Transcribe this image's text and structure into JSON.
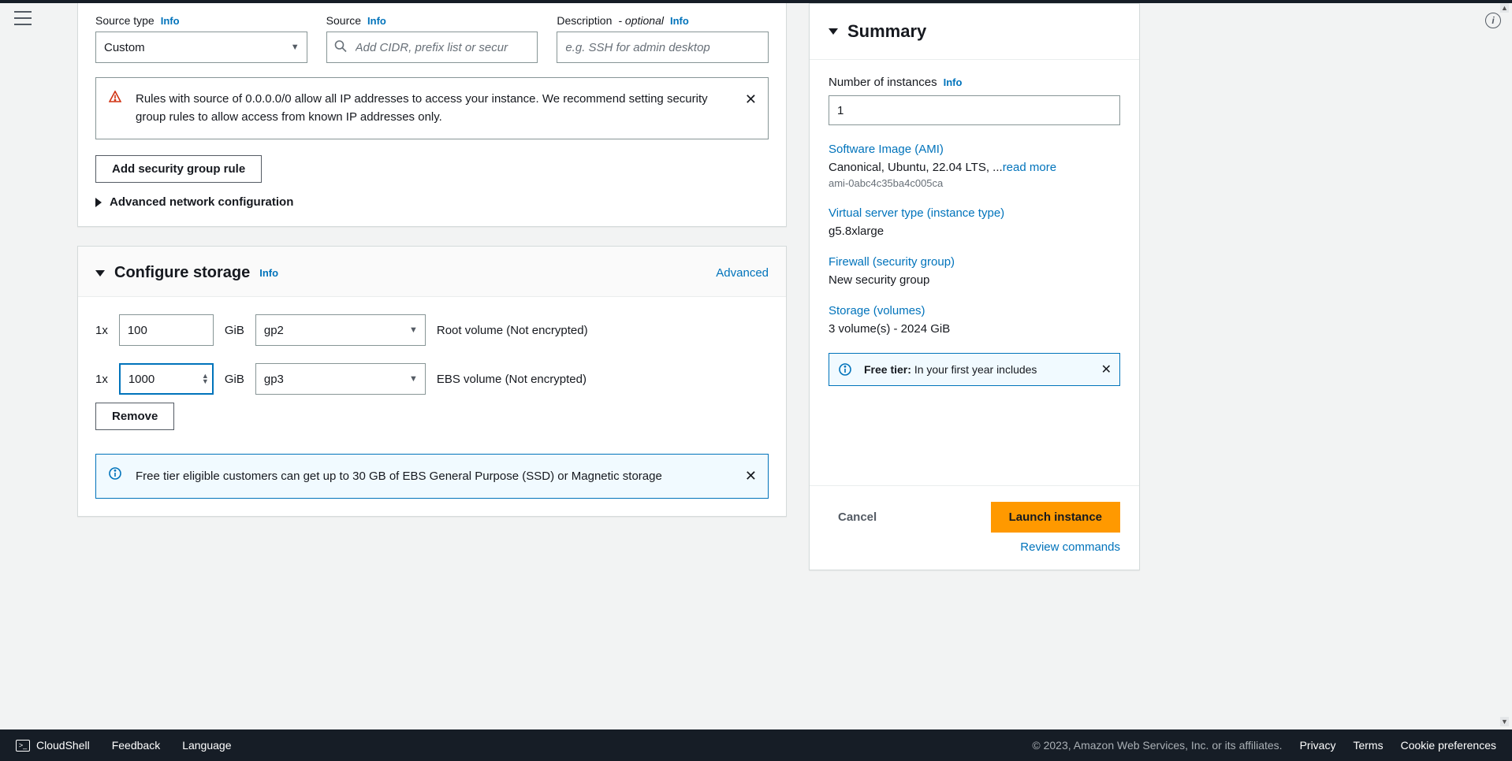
{
  "security": {
    "source_type_label": "Source type",
    "source_type_value": "Custom",
    "source_label": "Source",
    "source_placeholder": "Add CIDR, prefix list or secur",
    "description_label": "Description",
    "description_optional": "- optional",
    "description_placeholder": "e.g. SSH for admin desktop",
    "info": "Info",
    "warning": "Rules with source of 0.0.0.0/0 allow all IP addresses to access your instance. We recommend setting security group rules to allow access from known IP addresses only.",
    "add_rule_btn": "Add security group rule",
    "advanced_network": "Advanced network configuration"
  },
  "storage": {
    "title": "Configure storage",
    "info": "Info",
    "advanced": "Advanced",
    "rows": [
      {
        "mult": "1x",
        "size": "100",
        "unit": "GiB",
        "type": "gp2",
        "desc": "Root volume  (Not encrypted)"
      },
      {
        "mult": "1x",
        "size": "1000",
        "unit": "GiB",
        "type": "gp3",
        "desc": "EBS volume  (Not encrypted)"
      }
    ],
    "remove_btn": "Remove",
    "free_tier": "Free tier eligible customers can get up to 30 GB of EBS General Purpose (SSD) or Magnetic storage"
  },
  "summary": {
    "title": "Summary",
    "num_instances_label": "Number of instances",
    "num_instances_value": "1",
    "info": "Info",
    "ami_label": "Software Image (AMI)",
    "ami_text": "Canonical, Ubuntu, 22.04 LTS, ...",
    "read_more": "read more",
    "ami_id": "ami-0abc4c35ba4c005ca",
    "instance_type_label": "Virtual server type (instance type)",
    "instance_type_value": "g5.8xlarge",
    "firewall_label": "Firewall (security group)",
    "firewall_value": "New security group",
    "storage_label": "Storage (volumes)",
    "storage_value": "3 volume(s) - 2024 GiB",
    "free_tier_label": "Free tier:",
    "free_tier_text": "In your first year includes",
    "cancel": "Cancel",
    "launch": "Launch instance",
    "review": "Review commands"
  },
  "footer": {
    "cloudshell": "CloudShell",
    "feedback": "Feedback",
    "language": "Language",
    "copyright": "© 2023, Amazon Web Services, Inc. or its affiliates.",
    "privacy": "Privacy",
    "terms": "Terms",
    "cookie": "Cookie preferences"
  }
}
